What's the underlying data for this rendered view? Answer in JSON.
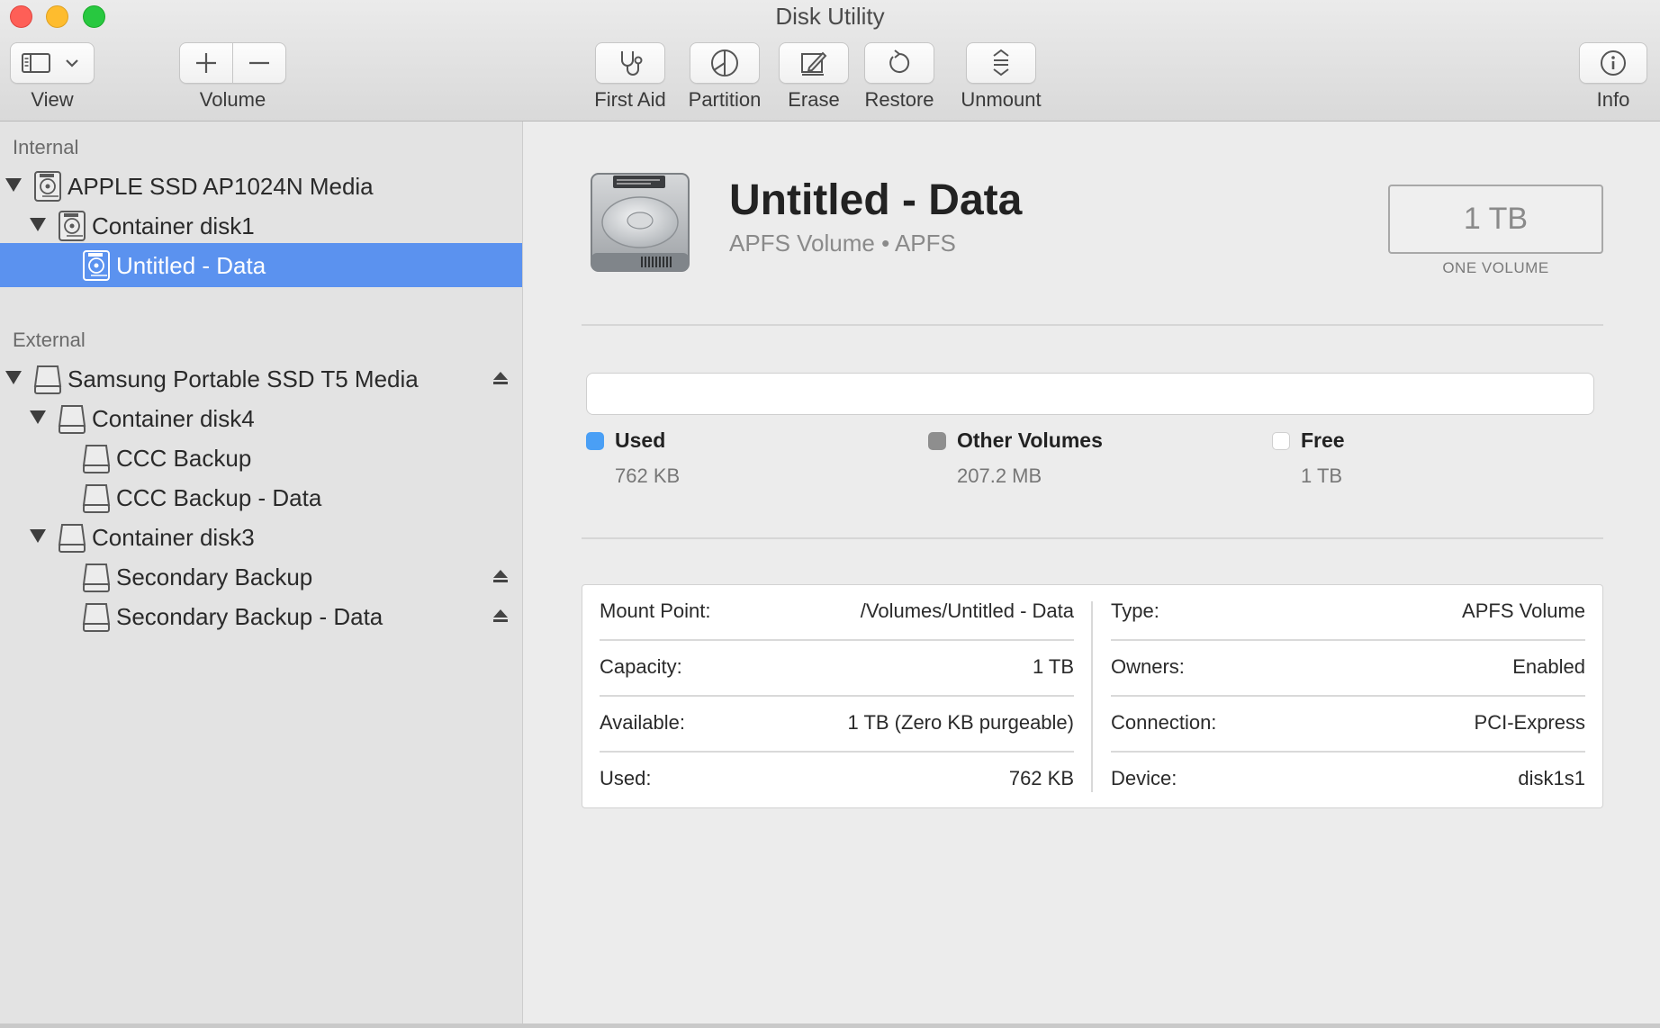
{
  "window": {
    "title": "Disk Utility"
  },
  "toolbar": {
    "view_label": "View",
    "volume_label": "Volume",
    "first_aid_label": "First Aid",
    "partition_label": "Partition",
    "erase_label": "Erase",
    "restore_label": "Restore",
    "unmount_label": "Unmount",
    "info_label": "Info"
  },
  "sidebar": {
    "internal_heading": "Internal",
    "external_heading": "External",
    "internal": [
      {
        "label": "APPLE SSD AP1024N Media",
        "level": 0,
        "expanded": true,
        "icon": "internal-disk-icon"
      },
      {
        "label": "Container disk1",
        "level": 1,
        "expanded": true,
        "icon": "internal-disk-icon"
      },
      {
        "label": "Untitled - Data",
        "level": 2,
        "selected": true,
        "icon": "internal-volume-icon"
      }
    ],
    "external": [
      {
        "label": "Samsung Portable SSD T5 Media",
        "level": 0,
        "expanded": true,
        "eject": true,
        "icon": "external-disk-icon"
      },
      {
        "label": "Container disk4",
        "level": 1,
        "expanded": true,
        "icon": "external-disk-icon"
      },
      {
        "label": "CCC Backup",
        "level": 2,
        "icon": "external-volume-icon"
      },
      {
        "label": "CCC Backup - Data",
        "level": 2,
        "icon": "external-volume-icon"
      },
      {
        "label": "Container disk3",
        "level": 1,
        "expanded": true,
        "icon": "external-disk-icon"
      },
      {
        "label": "Secondary Backup",
        "level": 2,
        "eject": true,
        "icon": "external-volume-icon"
      },
      {
        "label": "Secondary Backup - Data",
        "level": 2,
        "eject": true,
        "icon": "external-volume-icon"
      }
    ]
  },
  "volume": {
    "name": "Untitled - Data",
    "subtitle": "APFS Volume • APFS",
    "capacity": "1 TB",
    "capacity_caption": "ONE VOLUME"
  },
  "usage": {
    "used": {
      "label": "Used",
      "value": "762 KB",
      "color": "#4a9ff5",
      "fraction": 0.0
    },
    "other": {
      "label": "Other Volumes",
      "value": "207.2 MB",
      "color": "#8e8e8e",
      "fraction": 0.0
    },
    "free": {
      "label": "Free",
      "value": "1 TB",
      "color": "#ffffff"
    }
  },
  "info": {
    "left": [
      {
        "key": "Mount Point:",
        "value": "/Volumes/Untitled - Data"
      },
      {
        "key": "Capacity:",
        "value": "1 TB"
      },
      {
        "key": "Available:",
        "value": "1 TB (Zero KB purgeable)"
      },
      {
        "key": "Used:",
        "value": "762 KB"
      }
    ],
    "right": [
      {
        "key": "Type:",
        "value": "APFS Volume"
      },
      {
        "key": "Owners:",
        "value": "Enabled"
      },
      {
        "key": "Connection:",
        "value": "PCI-Express"
      },
      {
        "key": "Device:",
        "value": "disk1s1"
      }
    ]
  }
}
